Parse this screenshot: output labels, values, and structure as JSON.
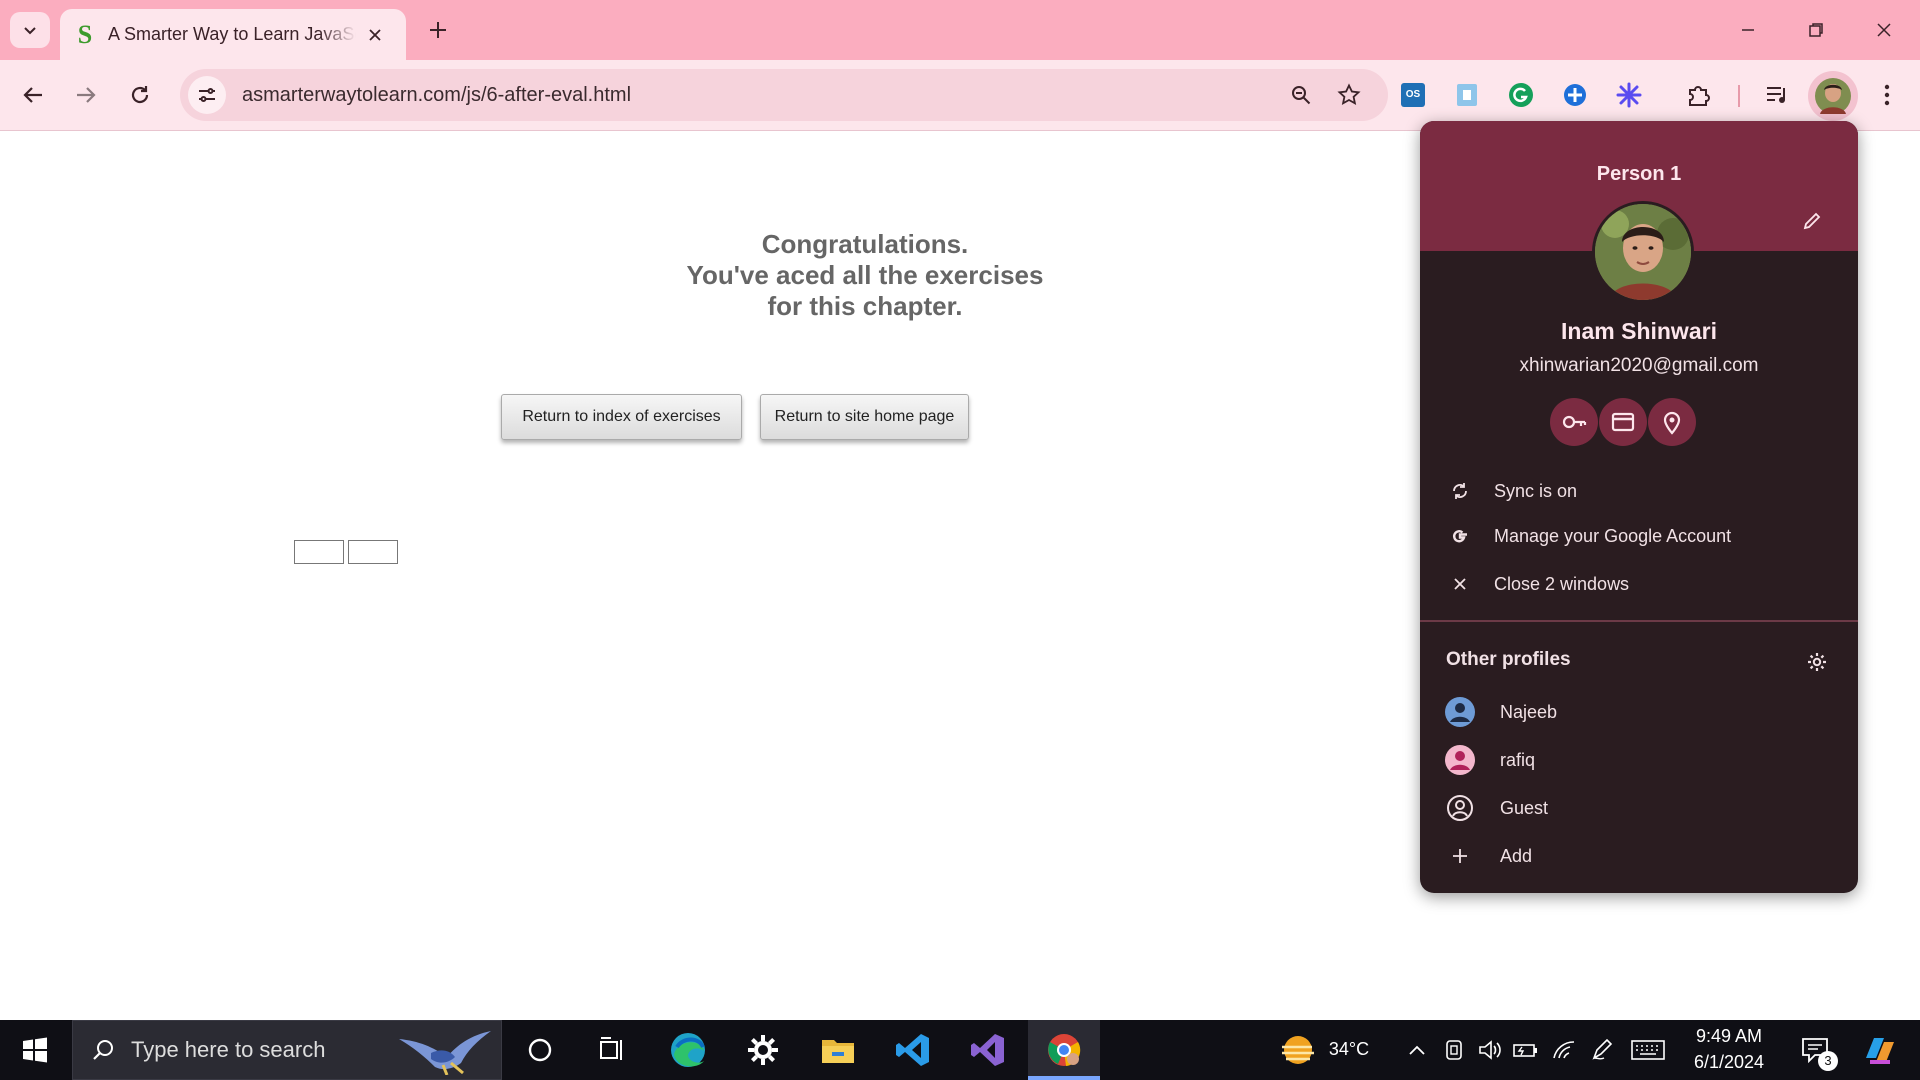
{
  "browser": {
    "tab": {
      "title": "A Smarter Way to Learn JavaScript",
      "favicon_letter": "S"
    },
    "url": "asmarterwaytolearn.com/js/6-after-eval.html"
  },
  "page": {
    "congrats_lines": [
      "Congratulations.",
      "You've aced all the exercises",
      "for this chapter."
    ],
    "buttons": {
      "index": "Return to index of exercises",
      "home": "Return to site home page"
    }
  },
  "profile_menu": {
    "person_label": "Person 1",
    "name": "Inam Shinwari",
    "email": "xhinwarian2020@gmail.com",
    "quick_actions": [
      "key-icon",
      "credit-card-icon",
      "location-pin-icon"
    ],
    "items": [
      {
        "icon": "sync-icon",
        "label": "Sync is on"
      },
      {
        "icon": "google-icon",
        "label": "Manage your Google Account"
      },
      {
        "icon": "close-icon",
        "label": "Close 2 windows"
      }
    ],
    "other_profiles_title": "Other profiles",
    "profiles": [
      {
        "label": "Najeeb",
        "color": "#6e9bd6"
      },
      {
        "label": "rafiq",
        "color": "#e06e9b"
      },
      {
        "label": "Guest",
        "color": "#f1e1e5"
      }
    ],
    "add_label": "Add"
  },
  "taskbar": {
    "search_placeholder": "Type here to search",
    "weather": "34°C",
    "time": "9:49 AM",
    "date": "6/1/2024",
    "notification_count": "3"
  },
  "colors": {
    "tabstrip": "#fbadbf",
    "toolbar": "#fde6ec",
    "menu_header": "#7b2b41",
    "menu_body": "#2a1c20"
  }
}
